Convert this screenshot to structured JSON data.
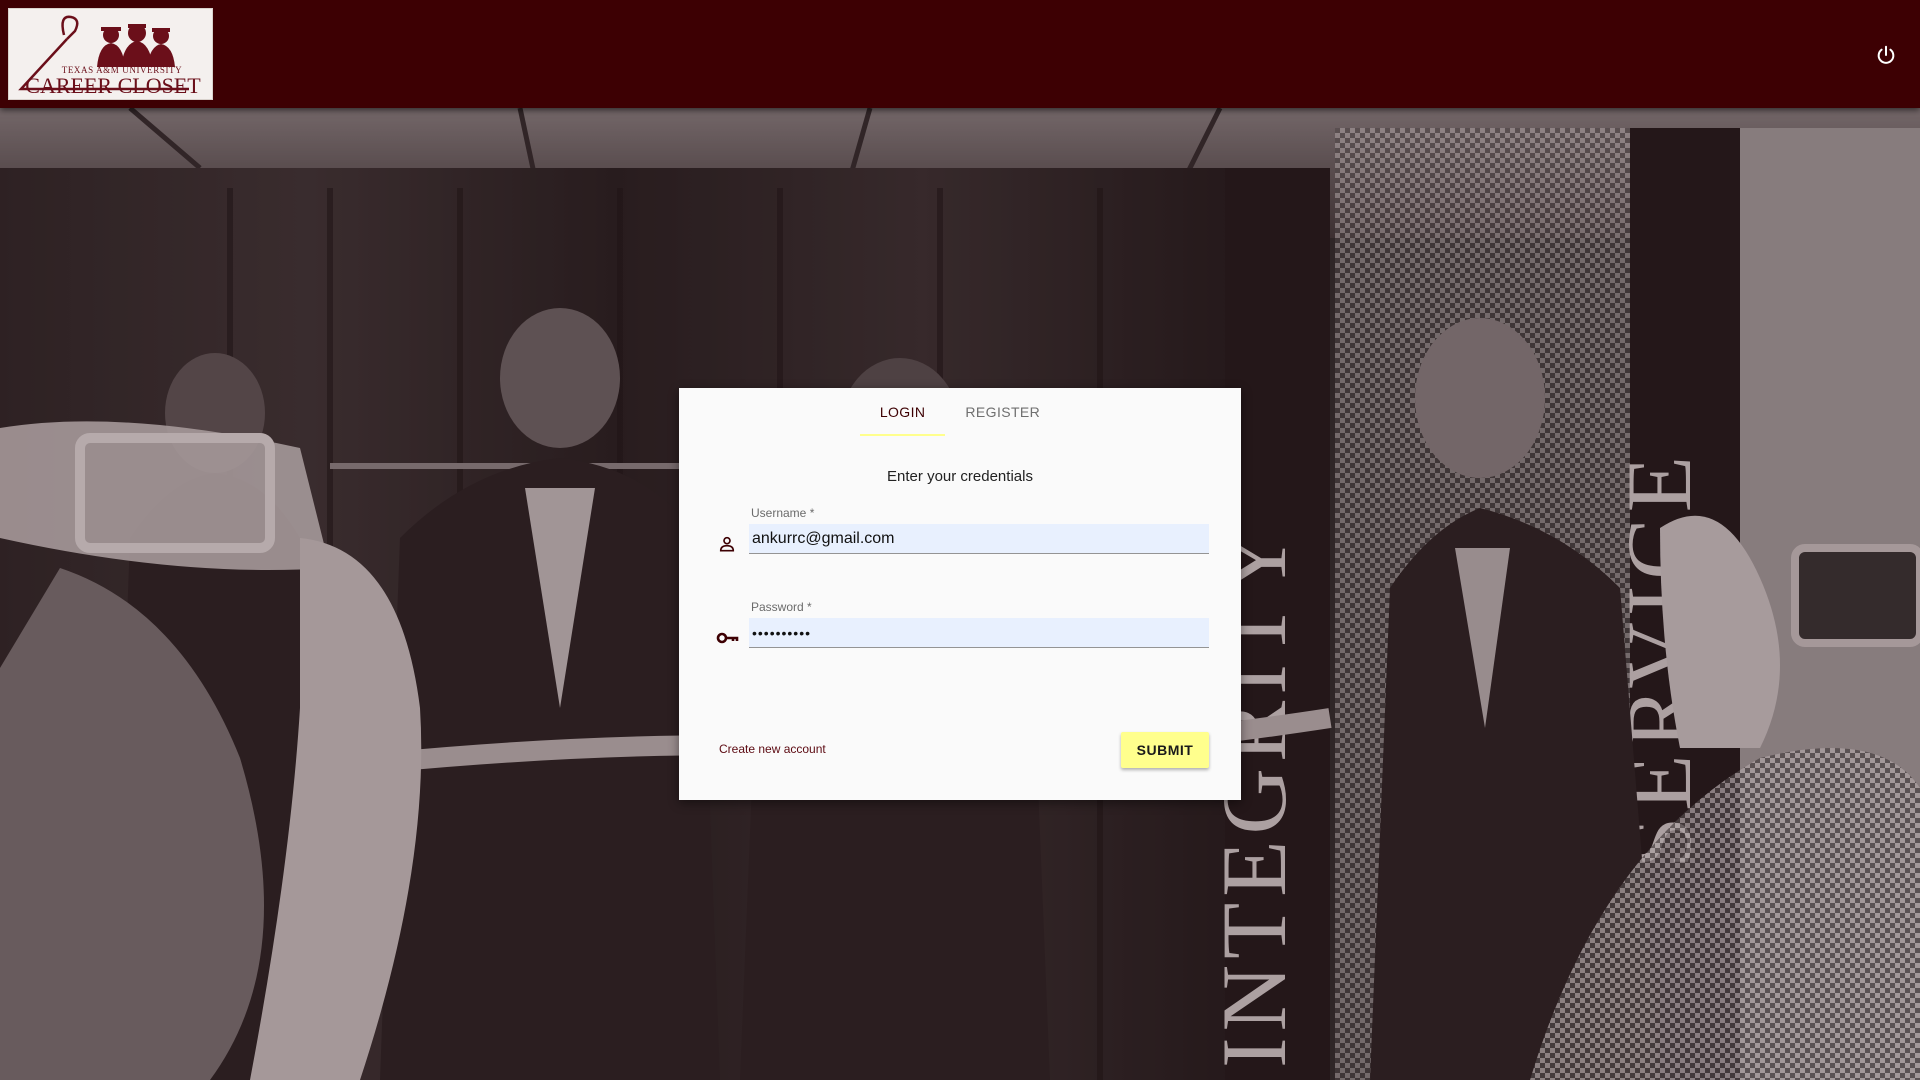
{
  "header": {
    "logo_top_text": "TEXAS A&M UNIVERSITY",
    "logo_main_text": "CAREER CLOSET",
    "power_icon": "power-icon"
  },
  "login": {
    "tabs": [
      {
        "label": "LOGIN",
        "active": true
      },
      {
        "label": "REGISTER",
        "active": false
      }
    ],
    "subtitle": "Enter your credentials",
    "username": {
      "label": "Username *",
      "value": "ankurrc@gmail.com",
      "icon": "person-icon"
    },
    "password": {
      "label": "Password *",
      "value": "••••••••••",
      "icon": "key-icon"
    },
    "create_account_label": "Create new account",
    "submit_label": "SUBMIT"
  },
  "background": {
    "banner_left_text": "INTEGRITY",
    "banner_right_text": "SERVICE"
  },
  "colors": {
    "header_bg": "#3d0003",
    "accent_yellow": "#ffff8d",
    "maroon": "#500000",
    "autofill_bg": "#e8f0fe"
  }
}
